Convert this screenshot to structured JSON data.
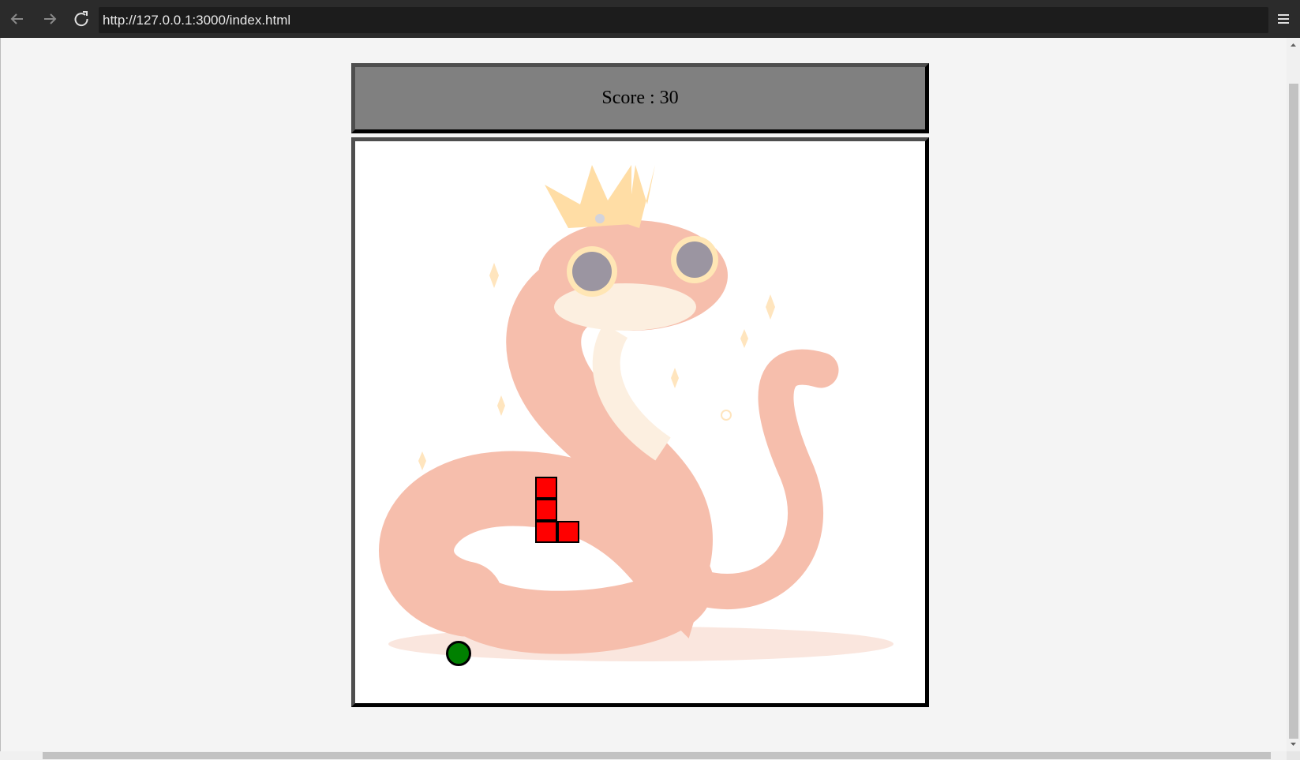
{
  "browser": {
    "url": "http://127.0.0.1:3000/index.html",
    "back_icon": "arrow-left-icon",
    "forward_icon": "arrow-right-icon",
    "reload_icon": "reload-icon",
    "menu_icon": "hamburger-menu-icon"
  },
  "game": {
    "score_text": "Score : 30",
    "snake_color": "#ff0000",
    "food_color": "#008000",
    "background_image": "crowned-red-snake-illustration"
  }
}
